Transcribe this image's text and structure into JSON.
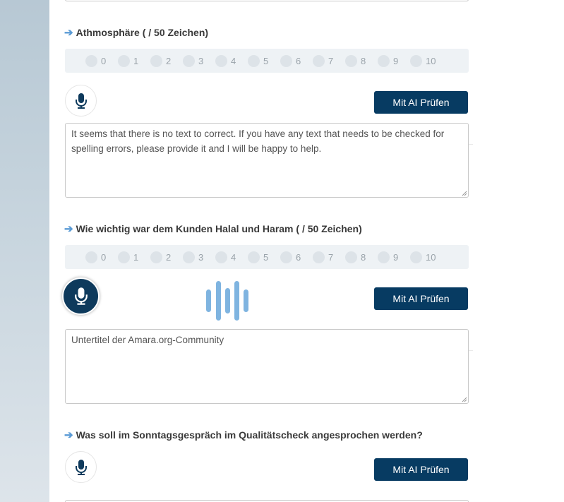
{
  "colors": {
    "accent": "#073b62",
    "arrow": "#5b9bd5",
    "wave": "#7fb4e0",
    "rating_bg": "#eef2f5"
  },
  "rating_numbers": [
    "0",
    "1",
    "2",
    "3",
    "4",
    "5",
    "6",
    "7",
    "8",
    "9",
    "10"
  ],
  "sections": [
    {
      "title": "Athmosphäre ( / 50 Zeichen)",
      "ai_button_label": "Mit AI Prüfen",
      "mic_state": "idle",
      "textarea_value": "It seems that there is no text to correct. If you have any text that needs to be checked for spelling errors, please provide it and I will be happy to help."
    },
    {
      "title": "Wie wichtig war dem Kunden Halal und Haram ( / 50 Zeichen)",
      "ai_button_label": "Mit AI Prüfen",
      "mic_state": "recording",
      "textarea_value": "Untertitel der Amara.org-Community"
    },
    {
      "title": "Was soll im Sonntagsgespräch im Qualitätscheck angesprochen werden?",
      "ai_button_label": "Mit AI Prüfen",
      "mic_state": "idle"
    }
  ],
  "icons": {
    "arrow": "arrow-right-icon",
    "mic": "microphone-icon",
    "wave": "audio-wave-icon"
  }
}
